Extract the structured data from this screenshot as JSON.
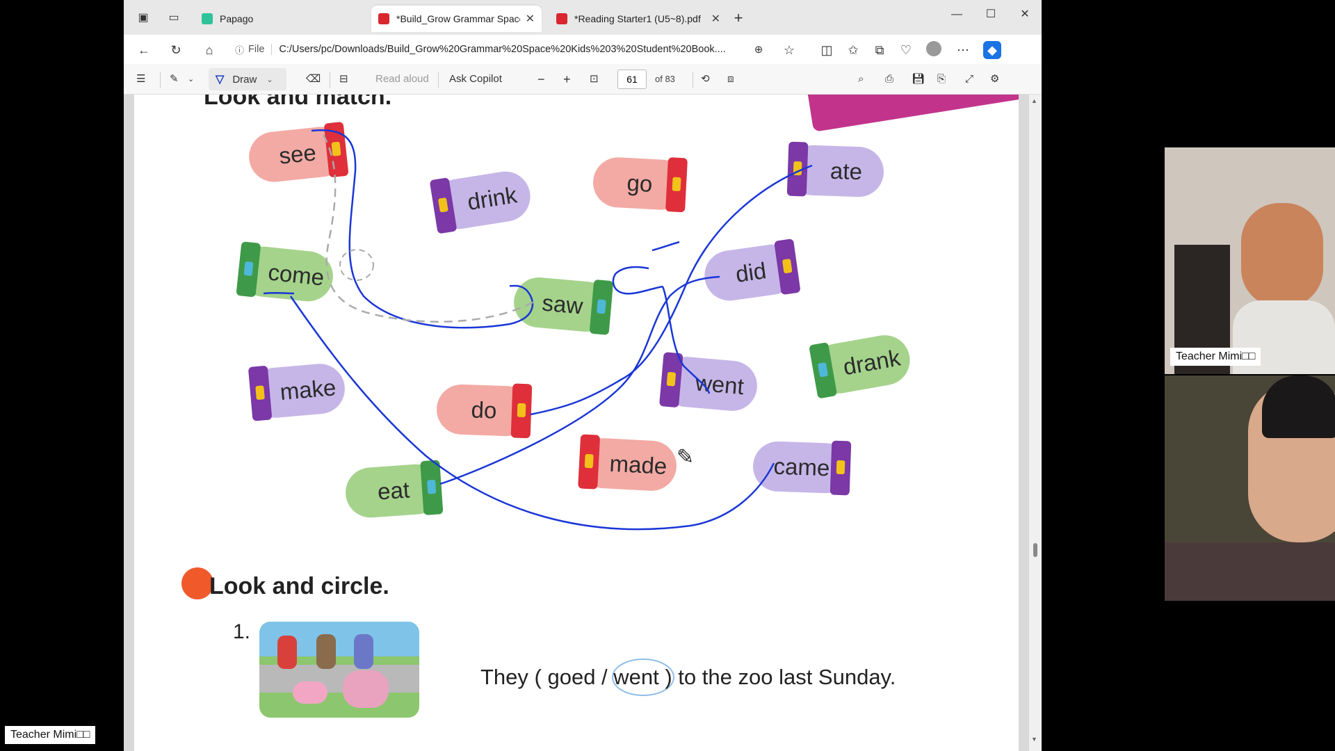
{
  "browser": {
    "tabs": [
      {
        "label": "Papago",
        "active": false
      },
      {
        "label": "*Build_Grow Grammar Space Kid",
        "active": true
      },
      {
        "label": "*Reading Starter1 (U5~8).pdf",
        "active": false
      }
    ],
    "url_scheme": "File",
    "url_path": "C:/Users/pc/Downloads/Build_Grow%20Grammar%20Space%20Kids%203%20Student%20Book....",
    "window_controls": [
      "minimize-icon",
      "maximize-icon",
      "close-icon"
    ]
  },
  "pdf_toolbar": {
    "draw_label": "Draw",
    "read_aloud_label": "Read aloud",
    "ask_copilot_label": "Ask Copilot",
    "page_current": "61",
    "page_total": "of 83"
  },
  "worksheet": {
    "heading_partial": "Look and match.",
    "mittens": [
      {
        "word": "see",
        "color": "pink"
      },
      {
        "word": "drink",
        "color": "purple"
      },
      {
        "word": "go",
        "color": "pink"
      },
      {
        "word": "ate",
        "color": "purple"
      },
      {
        "word": "come",
        "color": "green"
      },
      {
        "word": "saw",
        "color": "green"
      },
      {
        "word": "did",
        "color": "purple"
      },
      {
        "word": "make",
        "color": "purple"
      },
      {
        "word": "went",
        "color": "purple"
      },
      {
        "word": "drank",
        "color": "green"
      },
      {
        "word": "do",
        "color": "pink"
      },
      {
        "word": "made",
        "color": "pink"
      },
      {
        "word": "came",
        "color": "purple"
      },
      {
        "word": "eat",
        "color": "green"
      }
    ],
    "section_title": "Look and circle.",
    "question_number": "1.",
    "question_text": "They ( goed / went ) to the zoo last Sunday.",
    "ink_color": "#1a36d6"
  },
  "participants": {
    "teacher_tile_label": "Teacher Mimi□□",
    "bottom_left_label": "Teacher Mimi□□"
  }
}
